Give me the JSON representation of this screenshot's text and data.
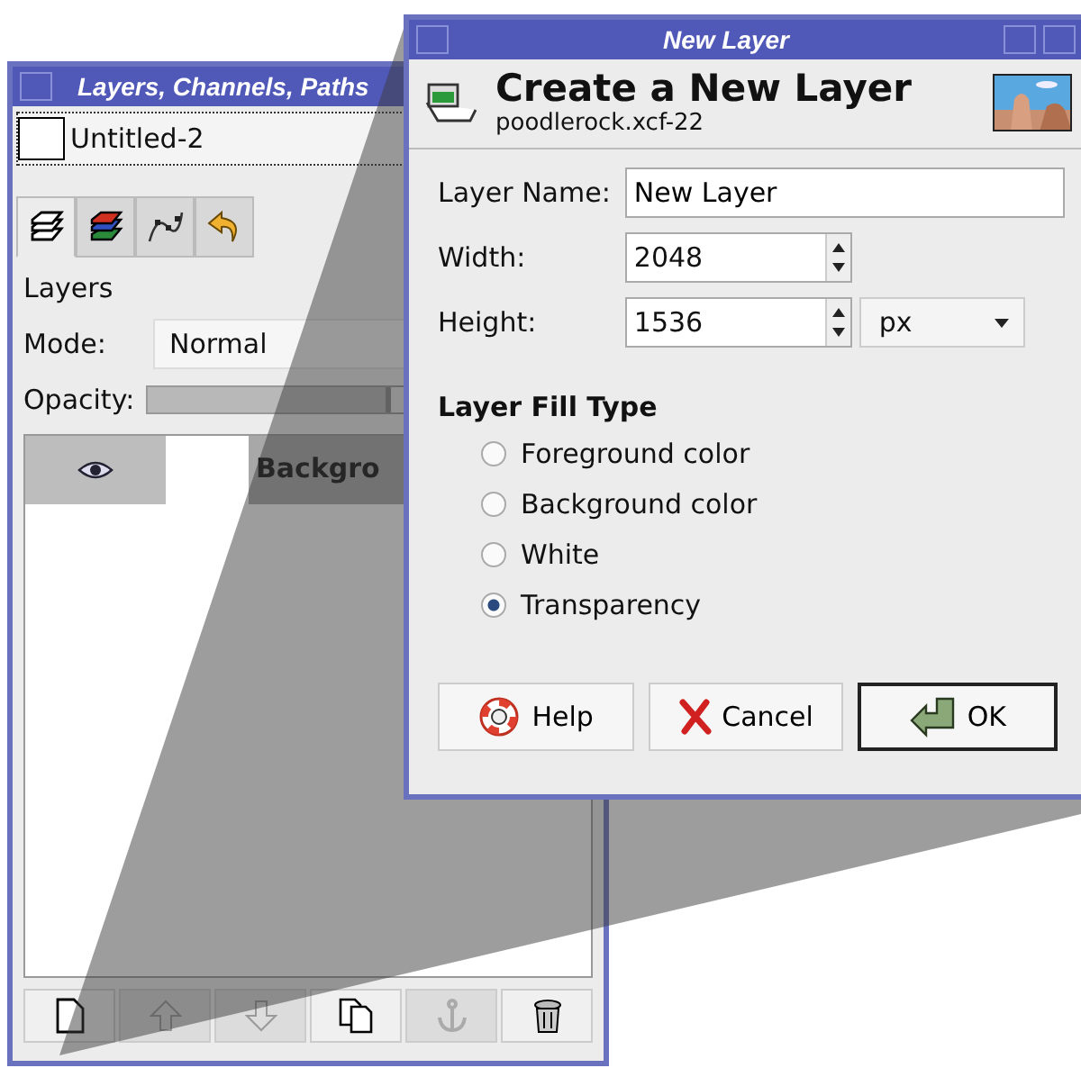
{
  "layers_window": {
    "title": "Layers, Channels, Paths",
    "image": "Untitled-2",
    "tabs": [
      {
        "kind": "layers",
        "selected": true
      },
      {
        "kind": "channels",
        "selected": false
      },
      {
        "kind": "paths",
        "selected": false
      },
      {
        "kind": "undo",
        "selected": false
      }
    ],
    "section": "Layers",
    "mode_label": "Mode:",
    "mode": "Normal",
    "opacity_label": "Opacity:",
    "opacity": {
      "level": 0.55
    },
    "layers": [
      {
        "name": "Backgro",
        "visible": true
      }
    ],
    "buttons": [
      {
        "kind": "new",
        "disabled": false
      },
      {
        "kind": "raise",
        "disabled": true
      },
      {
        "kind": "lower",
        "disabled": true
      },
      {
        "kind": "duplicate",
        "disabled": false
      },
      {
        "kind": "anchor",
        "disabled": true
      },
      {
        "kind": "delete",
        "disabled": false
      }
    ]
  },
  "dialog": {
    "title": "New Layer",
    "heading": "Create a New Layer",
    "subtitle": "poodlerock.xcf-22",
    "fields": [
      {
        "label": "Layer Name:",
        "value": "New Layer",
        "kind": "text"
      },
      {
        "label": "Width:",
        "value": "2048",
        "kind": "spin"
      },
      {
        "label": "Height:",
        "value": "1536",
        "kind": "spin",
        "unit": "px"
      }
    ],
    "fill_heading": "Layer Fill Type",
    "fill_options": [
      {
        "label": "Foreground color",
        "selected": false
      },
      {
        "label": "Background color",
        "selected": false
      },
      {
        "label": "White",
        "selected": false
      },
      {
        "label": "Transparency",
        "selected": true
      }
    ],
    "buttons": [
      {
        "label": "Help",
        "kind": "help",
        "default": false
      },
      {
        "label": "Cancel",
        "kind": "cancel",
        "default": false
      },
      {
        "label": "OK",
        "kind": "ok",
        "default": true
      }
    ]
  }
}
